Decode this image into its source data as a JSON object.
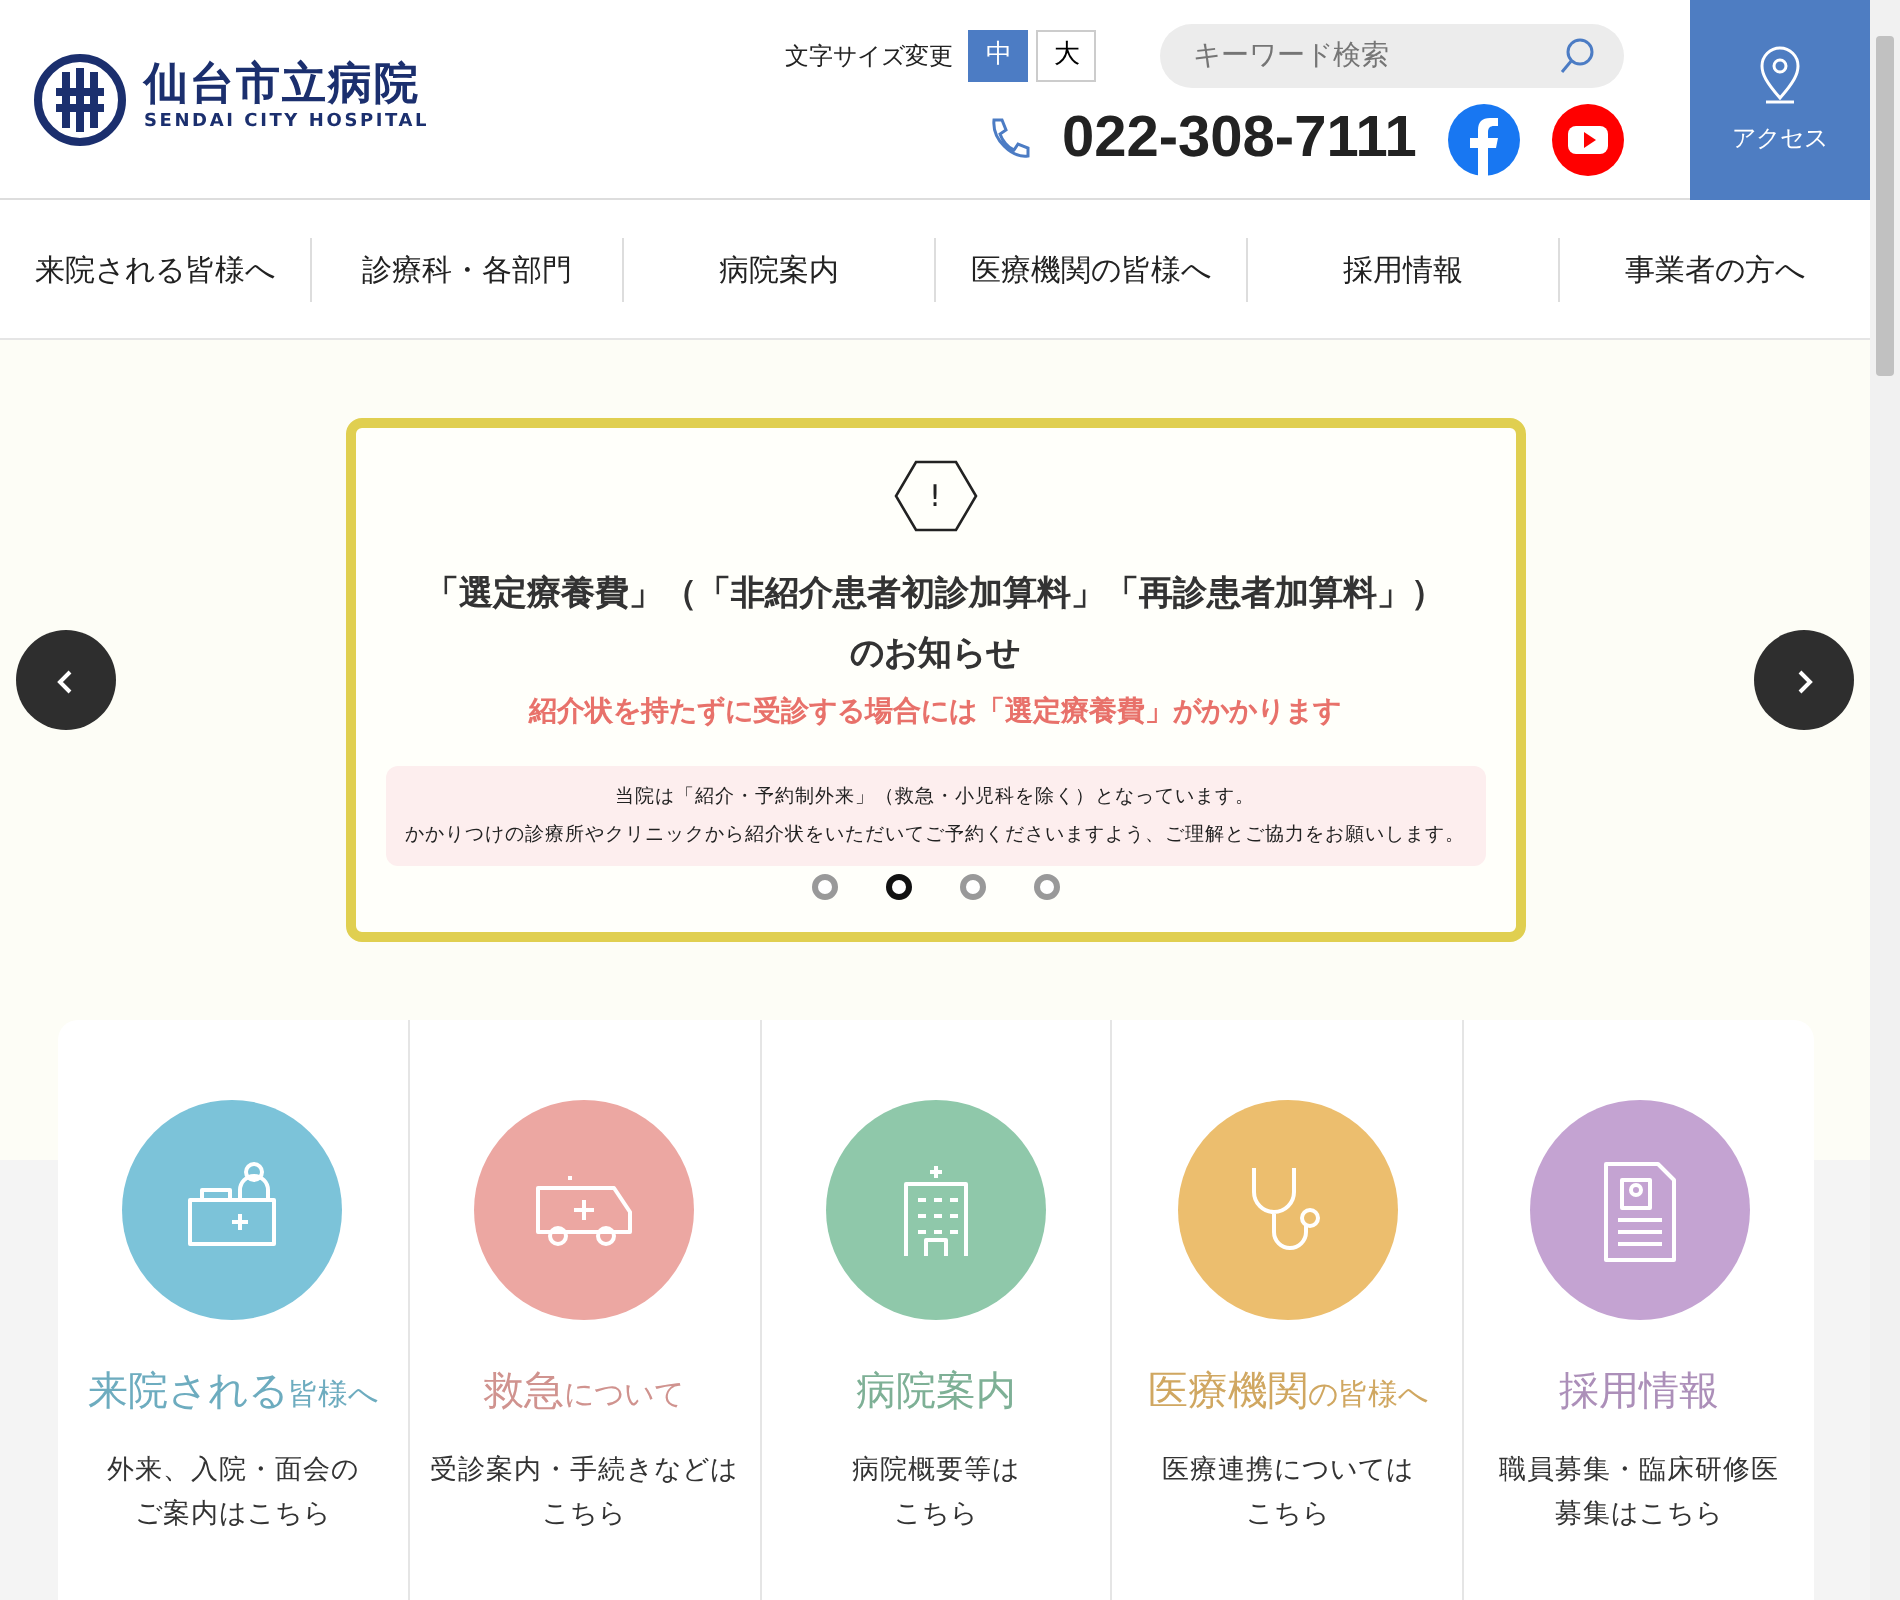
{
  "logo": {
    "name": "仙台市立病院",
    "sub": "SENDAI CITY HOSPITAL"
  },
  "font_size": {
    "label": "文字サイズ変更",
    "options": [
      {
        "label": "中",
        "selected": true
      },
      {
        "label": "大",
        "selected": false
      }
    ]
  },
  "search": {
    "placeholder": "キーワード検索"
  },
  "phone": "022-308-7111",
  "access": "アクセス",
  "nav": [
    "来院される皆様へ",
    "診療科・各部門",
    "病院案内",
    "医療機関の皆様へ",
    "採用情報",
    "事業者の方へ"
  ],
  "notice": {
    "icon": "!",
    "title": "「選定療養費」（「非紹介患者初診加算料」「再診患者加算料」）",
    "title2": "のお知らせ",
    "highlight": "紹介状を持たずに受診する場合には「選定療養費」がかかります",
    "body": [
      "当院は「紹介・予約制外来」（救急・小児科を除く）となっています。",
      "かかりつけの診療所やクリニックから紹介状をいただいてご予約くださいますよう、ご理解とご協力をお願いします。"
    ]
  },
  "carousel_dots": [
    {
      "selected": false
    },
    {
      "selected": true
    },
    {
      "selected": false
    },
    {
      "selected": false
    }
  ],
  "cards": [
    {
      "kind": "reception",
      "title_main": "来院される",
      "title_sub": "皆様へ",
      "color": "#7cc3d9",
      "desc": [
        "外来、入院・面会の",
        "ご案内はこちら"
      ]
    },
    {
      "kind": "ambulance",
      "title_main": "救急",
      "title_sub": "について",
      "color": "#eca7a2",
      "desc": [
        "受診案内・手続きなどは",
        "こちら"
      ]
    },
    {
      "kind": "building",
      "title_main": "病院案内",
      "color": "#8fc8aa",
      "desc": [
        "病院概要等は",
        "こちら"
      ]
    },
    {
      "kind": "stethoscope",
      "title_main": "医療機関",
      "title_sub": "の皆様へ",
      "color": "#ecbe6e",
      "desc": [
        "医療連携については",
        "こちら"
      ]
    },
    {
      "kind": "document",
      "title_main": "採用情報",
      "color": "#c4a3d2",
      "desc": [
        "職員募集・臨床研修医",
        "募集はこちら"
      ]
    }
  ]
}
